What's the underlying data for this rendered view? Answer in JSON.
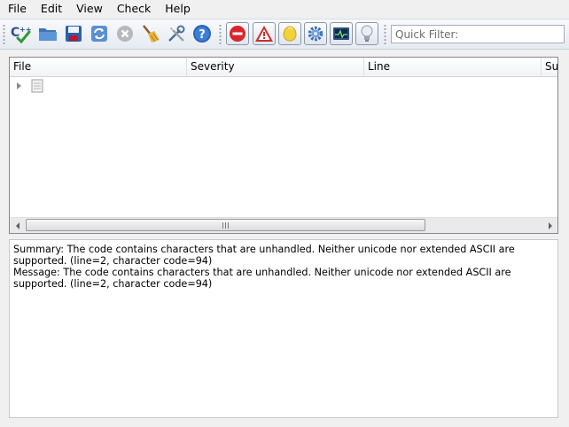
{
  "menu": [
    "File",
    "Edit",
    "View",
    "Check",
    "Help"
  ],
  "toolbar": {
    "buttons": [
      "check-cpp-icon",
      "open-folder-icon",
      "save-icon",
      "recheck-icon",
      "stop-icon",
      "clean-broom-icon",
      "settings-tools-icon",
      "help-icon"
    ],
    "filters": [
      "show-errors-icon",
      "show-warnings-icon",
      "show-style-icon",
      "show-performance-icon",
      "show-portability-icon",
      "show-information-icon"
    ],
    "filter_placeholder": "Quick Filter:"
  },
  "results": {
    "columns": [
      "File",
      "Severity",
      "Line",
      "Su"
    ]
  },
  "details": {
    "summary": "Summary: The code contains characters that are unhandled. Neither unicode nor extended ASCII are supported. (line=2, character code=94)",
    "message": "Message: The code contains characters that are unhandled. Neither unicode nor extended ASCII are supported. (line=2, character code=94)"
  },
  "colors": {
    "error_red": "#d9262b",
    "warning_red": "#c9302c",
    "style_yellow": "#f2d23a",
    "accent_blue": "#3a6fb5"
  }
}
